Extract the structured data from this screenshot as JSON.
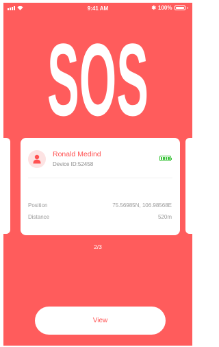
{
  "status_bar": {
    "time": "9:41 AM",
    "battery_percent": "100%",
    "icons": [
      "signal-icon",
      "wifi-icon",
      "bluetooth-icon",
      "battery-icon"
    ]
  },
  "title": "SOS",
  "card": {
    "name": "Ronald Medind",
    "device_id": "Device ID:52458",
    "battery_color": "#3bc43b",
    "rows": [
      {
        "label": "Position",
        "value": "75.56985N, 106.98568E"
      },
      {
        "label": "Distance",
        "value": "520m"
      }
    ]
  },
  "pager": "2/3",
  "view_button": "View",
  "colors": {
    "background": "#ff5c5c",
    "accent": "#ff5252",
    "card": "#ffffff"
  }
}
